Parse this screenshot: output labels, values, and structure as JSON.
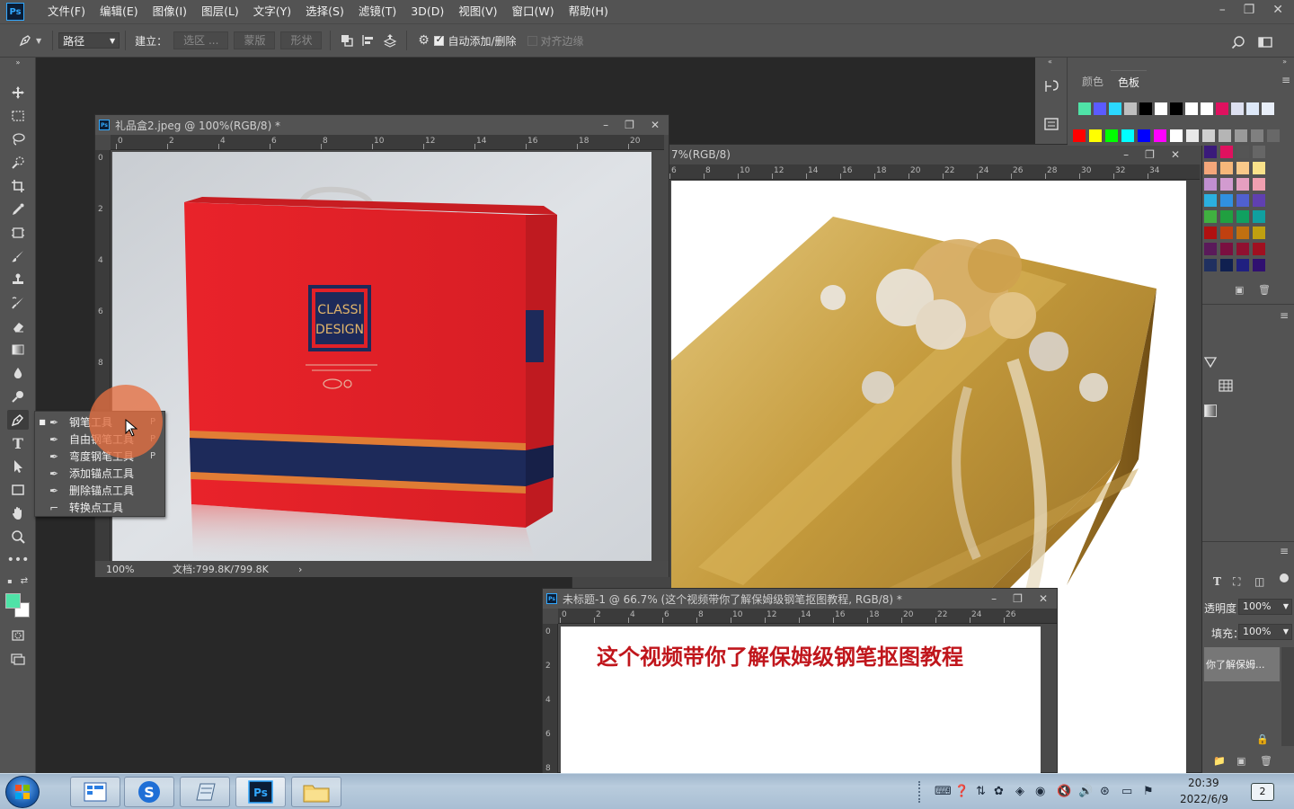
{
  "app": {
    "logo_text": "Ps"
  },
  "menu": [
    "文件(F)",
    "编辑(E)",
    "图像(I)",
    "图层(L)",
    "文字(Y)",
    "选择(S)",
    "滤镜(T)",
    "3D(D)",
    "视图(V)",
    "窗口(W)",
    "帮助(H)"
  ],
  "window_controls": {
    "minimize": "–",
    "restore": "❐",
    "close": "✕"
  },
  "options_bar": {
    "mode_value": "路径",
    "make_label": "建立：",
    "selection_button": "选区 ...",
    "mask_button": "蒙版",
    "shape_button": "形状",
    "auto_add_delete_label": "自动添加/删除",
    "auto_add_delete_checked": true,
    "align_edges_label": "对齐边缘",
    "align_edges_checked": false
  },
  "toolbar": {
    "foreground_color": "#4fe3a7",
    "background_color": "#ffffff"
  },
  "pen_flyout": [
    {
      "label": "钢笔工具",
      "key": "P",
      "active": true
    },
    {
      "label": "自由钢笔工具",
      "key": "P",
      "active": false
    },
    {
      "label": "弯度钢笔工具",
      "key": "P",
      "active": false
    },
    {
      "label": "添加锚点工具",
      "key": "",
      "active": false
    },
    {
      "label": "删除锚点工具",
      "key": "",
      "active": false
    },
    {
      "label": "转换点工具",
      "key": "",
      "active": false
    }
  ],
  "doc1": {
    "title": "礼品盒2.jpeg @ 100%(RGB/8) *",
    "zoom": "100%",
    "doc_size": "文档:799.8K/799.8K",
    "status_arrow": "›",
    "ruler_h": [
      "0",
      "2",
      "4",
      "6",
      "8",
      "10",
      "12",
      "14",
      "16",
      "18",
      "20"
    ],
    "ruler_v": [
      "0",
      "2",
      "4",
      "6",
      "8"
    ],
    "box_logo_line1": "CLASSI",
    "box_logo_line2": "DESIGN"
  },
  "doc2": {
    "title_fragment": "7%(RGB/8)",
    "ruler_h": [
      "6",
      "8",
      "10",
      "12",
      "14",
      "16",
      "18",
      "20",
      "22",
      "24",
      "26",
      "28",
      "30",
      "32",
      "34"
    ]
  },
  "doc3": {
    "title": "未标题-1 @ 66.7% (这个视频带你了解保姆级钢笔抠图教程, RGB/8) *",
    "canvas_text": "这个视频带你了解保姆级钢笔抠图教程",
    "ruler_h": [
      "0",
      "2",
      "4",
      "6",
      "8",
      "10",
      "12",
      "14",
      "16",
      "18",
      "20",
      "22",
      "24",
      "26"
    ],
    "ruler_v": [
      "0",
      "2",
      "4",
      "6",
      "8"
    ]
  },
  "panels": {
    "tab_color": "颜色",
    "tab_swatches": "色板",
    "opacity_label": "透明度：",
    "opacity_value": "100%",
    "fill_label": "填充：",
    "fill_value": "100%",
    "selected_layer": "你了解保姆..."
  },
  "taskbar": {
    "time": "20:39",
    "date": "2022/6/9",
    "notification_count": "2"
  }
}
